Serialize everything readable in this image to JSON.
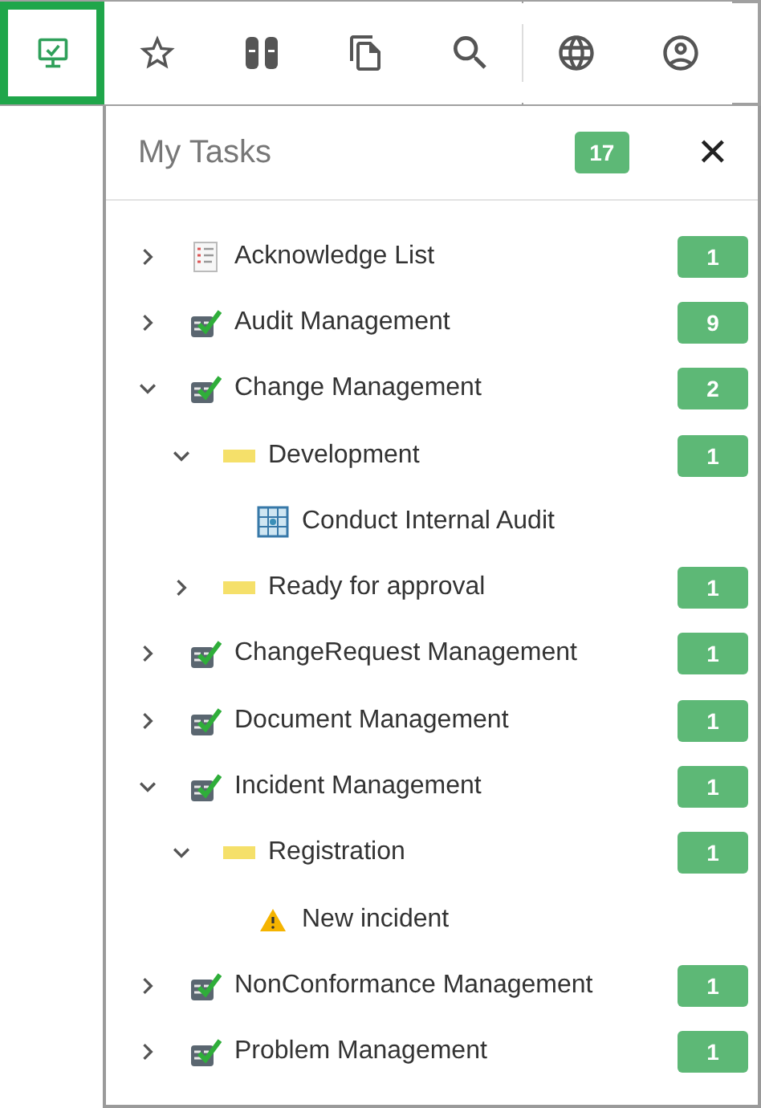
{
  "toolbar": [
    {
      "kind": "monitor",
      "selected": true
    },
    {
      "kind": "star",
      "selected": false
    },
    {
      "kind": "columns",
      "selected": false
    },
    {
      "kind": "copy",
      "selected": false
    },
    {
      "kind": "search",
      "selected": false
    },
    {
      "kind": "divider"
    },
    {
      "kind": "globe",
      "selected": false
    },
    {
      "kind": "account",
      "selected": false
    }
  ],
  "panel": {
    "title": "My Tasks",
    "count": "17",
    "close": "✕",
    "tree": [
      {
        "label": "Acknowledge List",
        "kind": "list",
        "count": "1",
        "expanded": false
      },
      {
        "label": "Audit Management",
        "kind": "process",
        "count": "9",
        "expanded": false
      },
      {
        "label": "Change Management",
        "kind": "process",
        "count": "2",
        "expanded": true,
        "children": [
          {
            "label": "Development",
            "kind": "folder",
            "count": "1",
            "expanded": true,
            "children": [
              {
                "label": "Conduct Internal Audit",
                "kind": "task"
              }
            ]
          },
          {
            "label": "Ready for approval",
            "kind": "folder",
            "count": "1",
            "expanded": false
          }
        ]
      },
      {
        "label": "ChangeRequest Management",
        "kind": "process",
        "count": "1",
        "expanded": false
      },
      {
        "label": "Document Management",
        "kind": "process",
        "count": "1",
        "expanded": false
      },
      {
        "label": "Incident Management",
        "kind": "process",
        "count": "1",
        "expanded": true,
        "children": [
          {
            "label": "Registration",
            "kind": "folder",
            "count": "1",
            "expanded": true,
            "children": [
              {
                "label": "New incident",
                "kind": "warning"
              }
            ]
          }
        ]
      },
      {
        "label": "NonConformance Management",
        "kind": "process",
        "count": "1",
        "expanded": false
      },
      {
        "label": "Problem Management",
        "kind": "process",
        "count": "1",
        "expanded": false
      }
    ]
  }
}
